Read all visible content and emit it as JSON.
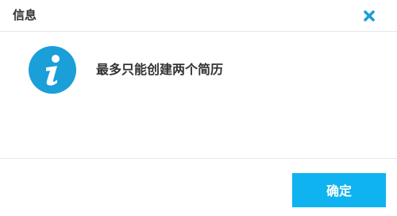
{
  "dialog": {
    "title": "信息",
    "close_icon": "close-icon",
    "message_icon": "info-icon",
    "message": "最多只能创建两个简历",
    "ok_label": "确定"
  },
  "colors": {
    "accent": "#0eb3f0",
    "icon_bg": "#1a9fd8",
    "close": "#1a9fd8",
    "text": "#333333"
  }
}
